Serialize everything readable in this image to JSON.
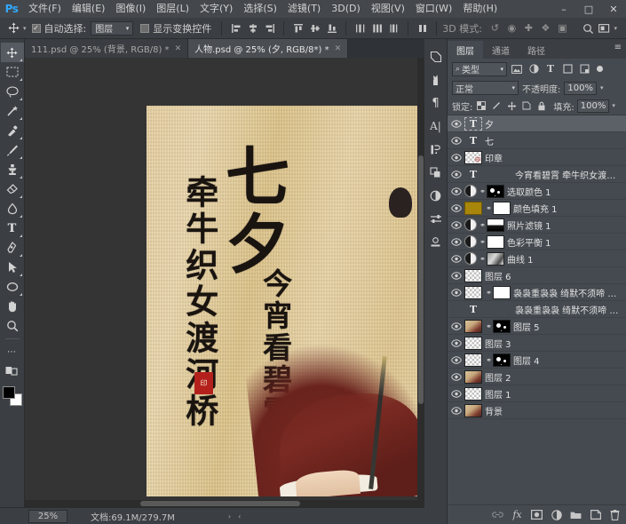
{
  "app": {
    "logo": "Ps",
    "menus": [
      {
        "label": "文件(F)"
      },
      {
        "label": "编辑(E)"
      },
      {
        "label": "图像(I)"
      },
      {
        "label": "图层(L)"
      },
      {
        "label": "文字(Y)"
      },
      {
        "label": "选择(S)"
      },
      {
        "label": "滤镜(T)"
      },
      {
        "label": "3D(D)"
      },
      {
        "label": "视图(V)"
      },
      {
        "label": "窗口(W)"
      },
      {
        "label": "帮助(H)"
      }
    ],
    "window_controls": {
      "minimize": "–",
      "maximize": "□",
      "close": "✕"
    }
  },
  "options_bar": {
    "tool_icon": "move-tool-icon",
    "tool_preset_caret": "▾",
    "auto_select_checked": true,
    "auto_select_label": "自动选择:",
    "auto_select_value": "图层",
    "show_transform_checked": false,
    "show_transform_label": "显示变换控件",
    "mode_3d_label": "3D 模式:",
    "search_icon": "search-icon",
    "arrange_icon": "arrange-documents-icon"
  },
  "tabs": [
    {
      "title": "111.psd @ 25% (背景, RGB/8) *",
      "active": false,
      "close": "✕"
    },
    {
      "title": "人物.psd @ 25% (夕, RGB/8*) *",
      "active": true,
      "close": "✕"
    }
  ],
  "toolbar": {
    "tools": [
      {
        "name": "move-tool",
        "glyph": "✥",
        "active": true
      },
      {
        "name": "rectangular-marquee-tool",
        "glyph": "⬚",
        "active": false
      },
      {
        "name": "lasso-tool",
        "glyph": "⟲",
        "active": false
      },
      {
        "name": "magic-wand-tool",
        "glyph": "✦",
        "active": false
      },
      {
        "name": "eyedropper-tool",
        "glyph": "✐",
        "active": false
      },
      {
        "name": "brush-tool",
        "glyph": "╱",
        "active": false
      },
      {
        "name": "clone-stamp-tool",
        "glyph": "⛃",
        "active": false
      },
      {
        "name": "eraser-tool",
        "glyph": "◢",
        "active": false
      },
      {
        "name": "gradient-tool",
        "glyph": "◑",
        "active": false
      },
      {
        "name": "type-tool",
        "glyph": "T",
        "active": false
      },
      {
        "name": "pen-tool",
        "glyph": "✒",
        "active": false
      },
      {
        "name": "path-selection-tool",
        "glyph": "➤",
        "active": false
      },
      {
        "name": "ellipse-tool",
        "glyph": "⬭",
        "active": false
      },
      {
        "name": "hand-tool",
        "glyph": "✋",
        "active": false
      },
      {
        "name": "zoom-tool",
        "glyph": "⌕",
        "active": false
      },
      {
        "name": "more-tools",
        "glyph": "···",
        "active": false
      },
      {
        "name": "quick-mask-toggle",
        "glyph": "◱",
        "active": false
      }
    ],
    "foreground_color": "#000000",
    "background_color": "#ffffff"
  },
  "canvas": {
    "calligraphy_title": "七夕",
    "calligraphy_line1": "牵牛织女渡河桥",
    "calligraphy_line2": "今宵看碧霄",
    "seal_text": "印",
    "paper_color": "#e0c793",
    "ink_color": "#1a1410",
    "seal_color": "#b4211d",
    "robe_color": "#7a2a22"
  },
  "status_bar": {
    "zoom": "25%",
    "doc_label": "文档:69.1M/279.7M",
    "caret": "›",
    "arrows": "‹"
  },
  "rail": {
    "buttons": [
      {
        "name": "color-panel-icon",
        "glyph": "◧"
      },
      {
        "name": "brush-panel-icon",
        "glyph": "⚘"
      },
      {
        "name": "paragraph-panel-icon",
        "glyph": "¶"
      },
      {
        "name": "character-panel-icon",
        "glyph": "A"
      },
      {
        "name": "history-panel-icon",
        "glyph": "↺"
      },
      {
        "name": "actions-panel-icon",
        "glyph": "▶"
      },
      {
        "name": "adjustments-panel-icon",
        "glyph": "◑"
      },
      {
        "name": "properties-panel-icon",
        "glyph": "☰"
      },
      {
        "name": "libraries-panel-icon",
        "glyph": "⚙"
      }
    ]
  },
  "panel": {
    "tabs": [
      {
        "label": "图层",
        "active": true
      },
      {
        "label": "通道",
        "active": false
      },
      {
        "label": "路径",
        "active": false
      }
    ],
    "menu_icon": "≡",
    "filter": {
      "search_icon": "⌕",
      "type_label": "类型",
      "caret": "▾",
      "icons": [
        {
          "name": "filter-pixel-icon",
          "glyph": "▣"
        },
        {
          "name": "filter-adjustment-icon",
          "glyph": "◑"
        },
        {
          "name": "filter-type-icon",
          "glyph": "T"
        },
        {
          "name": "filter-shape-icon",
          "glyph": "□"
        },
        {
          "name": "filter-smart-object-icon",
          "glyph": "❖"
        }
      ],
      "toggle_name": "filter-enable-toggle"
    },
    "blend_mode_label": "正常",
    "opacity_label": "不透明度:",
    "opacity_value": "100%",
    "lock_label": "锁定:",
    "lock_icons": [
      {
        "name": "lock-transparent-pixels-icon",
        "glyph": "▨"
      },
      {
        "name": "lock-image-pixels-icon",
        "glyph": "╱"
      },
      {
        "name": "lock-position-icon",
        "glyph": "✛"
      },
      {
        "name": "lock-artboard-nesting-icon",
        "glyph": "⬚"
      },
      {
        "name": "lock-all-icon",
        "glyph": "⚿"
      }
    ],
    "fill_label": "填充:",
    "fill_value": "100%",
    "caret": "▾",
    "eye_glyph": "◉",
    "link_glyph": "⚭",
    "layers": [
      {
        "name": "夕",
        "thumb": "type-boxed",
        "selected": true,
        "visible": true,
        "has_link": false,
        "mask": null,
        "indent": false
      },
      {
        "name": "七",
        "thumb": "type",
        "selected": false,
        "visible": true,
        "has_link": false,
        "mask": null,
        "indent": false
      },
      {
        "name": "印章",
        "thumb": "checker-stamp",
        "selected": false,
        "visible": true,
        "has_link": false,
        "mask": null,
        "indent": false
      },
      {
        "name": "今宵看碧霄 牵牛织女渡河桥",
        "thumb": "type",
        "selected": false,
        "visible": true,
        "has_link": false,
        "mask": null,
        "indent": true
      },
      {
        "name": "选取颜色 1",
        "thumb": "adjustment",
        "selected": false,
        "visible": true,
        "has_link": true,
        "mask": "black-dots",
        "indent": false
      },
      {
        "name": "颜色填充 1",
        "thumb": "gold",
        "selected": false,
        "visible": true,
        "has_link": true,
        "mask": "white",
        "indent": false
      },
      {
        "name": "照片滤镜 1",
        "thumb": "adjustment",
        "selected": false,
        "visible": true,
        "has_link": true,
        "mask": "mountains",
        "indent": false
      },
      {
        "name": "色彩平衡 1",
        "thumb": "adjustment",
        "selected": false,
        "visible": true,
        "has_link": true,
        "mask": "white",
        "indent": false
      },
      {
        "name": "曲线 1",
        "thumb": "adjustment",
        "selected": false,
        "visible": true,
        "has_link": true,
        "mask": "curve",
        "indent": false
      },
      {
        "name": "图层 6",
        "thumb": "checker",
        "selected": false,
        "visible": true,
        "has_link": false,
        "mask": null,
        "indent": false
      },
      {
        "name": "袅袅重袅袅 绮默不须啼 愿…",
        "thumb": "checker",
        "selected": false,
        "visible": true,
        "has_link": true,
        "mask": "white",
        "indent": false
      },
      {
        "name": "袅袅重袅袅 绮默不须啼 愿得一人…",
        "thumb": "type",
        "selected": false,
        "visible": false,
        "has_link": false,
        "mask": null,
        "indent": true
      },
      {
        "name": "图层 5",
        "thumb": "photo",
        "selected": false,
        "visible": true,
        "has_link": true,
        "mask": "black-dots",
        "indent": false
      },
      {
        "name": "图层 3",
        "thumb": "checker",
        "selected": false,
        "visible": true,
        "has_link": false,
        "mask": null,
        "indent": false
      },
      {
        "name": "图层 4",
        "thumb": "checker",
        "selected": false,
        "visible": true,
        "has_link": true,
        "mask": "black-dots",
        "indent": false
      },
      {
        "name": "图层 2",
        "thumb": "photo",
        "selected": false,
        "visible": true,
        "has_link": false,
        "mask": null,
        "indent": false
      },
      {
        "name": "图层 1",
        "thumb": "checker",
        "selected": false,
        "visible": true,
        "has_link": false,
        "mask": null,
        "indent": false
      },
      {
        "name": "背景",
        "thumb": "photo",
        "selected": false,
        "visible": true,
        "has_link": false,
        "mask": null,
        "indent": false
      }
    ],
    "footer_icons": [
      {
        "name": "link-layers-icon",
        "glyph": "⚭",
        "dim": true
      },
      {
        "name": "layer-style-fx-icon",
        "glyph": "fx",
        "dim": false
      },
      {
        "name": "add-layer-mask-icon",
        "glyph": "▣",
        "dim": false
      },
      {
        "name": "new-adjustment-layer-icon",
        "glyph": "◑",
        "dim": false
      },
      {
        "name": "new-group-icon",
        "glyph": "▰",
        "dim": false
      },
      {
        "name": "new-layer-icon",
        "glyph": "❐",
        "dim": false
      },
      {
        "name": "delete-layer-icon",
        "glyph": "⌧",
        "dim": false
      }
    ]
  }
}
